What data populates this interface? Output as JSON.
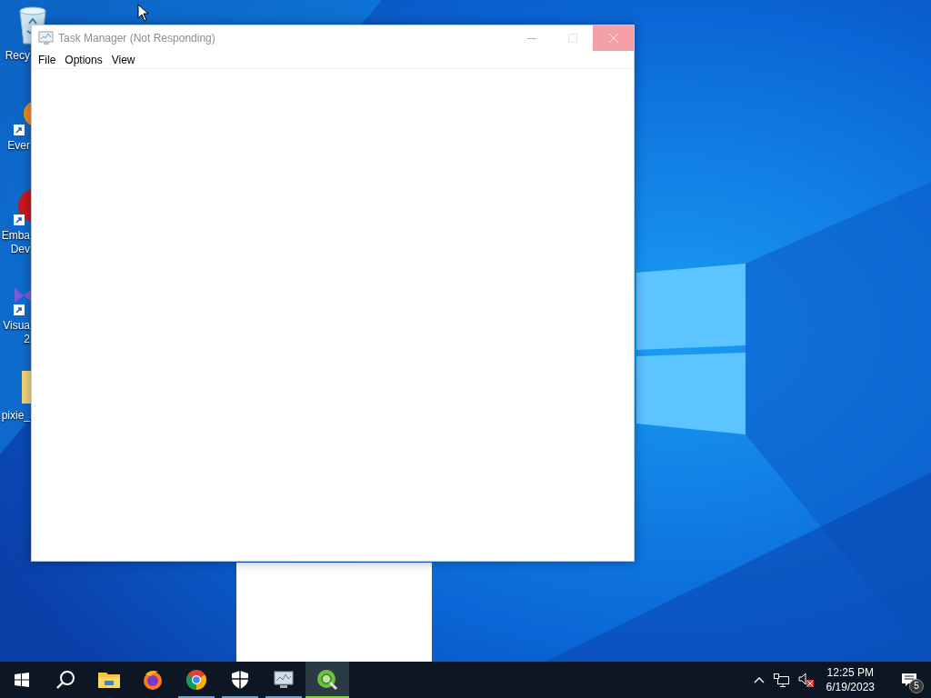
{
  "desktop_icons": [
    {
      "kind": "recycle-bin",
      "lines": [
        "Recy"
      ],
      "shortcut": false
    },
    {
      "kind": "orange-app",
      "lines": [
        "Ever"
      ],
      "shortcut": true
    },
    {
      "kind": "red-app",
      "lines": [
        "Emba",
        "Dev"
      ],
      "shortcut": true
    },
    {
      "kind": "purple-app",
      "lines": [
        "Visua",
        "2"
      ],
      "shortcut": true
    },
    {
      "kind": "folder",
      "lines": [
        "pixie_"
      ],
      "shortcut": false
    }
  ],
  "window": {
    "title": "Task Manager (Not Responding)",
    "menu": [
      "File",
      "Options",
      "View"
    ]
  },
  "taskbar": {
    "items": [
      {
        "kind": "start",
        "running": false,
        "selected": false
      },
      {
        "kind": "search",
        "running": false,
        "selected": false
      },
      {
        "kind": "folder",
        "running": false,
        "selected": false
      },
      {
        "kind": "firefox",
        "running": false,
        "selected": false
      },
      {
        "kind": "chrome",
        "running": true,
        "selected": false
      },
      {
        "kind": "shield",
        "running": true,
        "selected": false
      },
      {
        "kind": "monitor",
        "running": true,
        "selected": false
      },
      {
        "kind": "magnifier-app",
        "running": true,
        "selected": true
      }
    ]
  },
  "tray": {
    "muted": true,
    "time": "12:25 PM",
    "date": "6/19/2023",
    "notifications": "5"
  }
}
